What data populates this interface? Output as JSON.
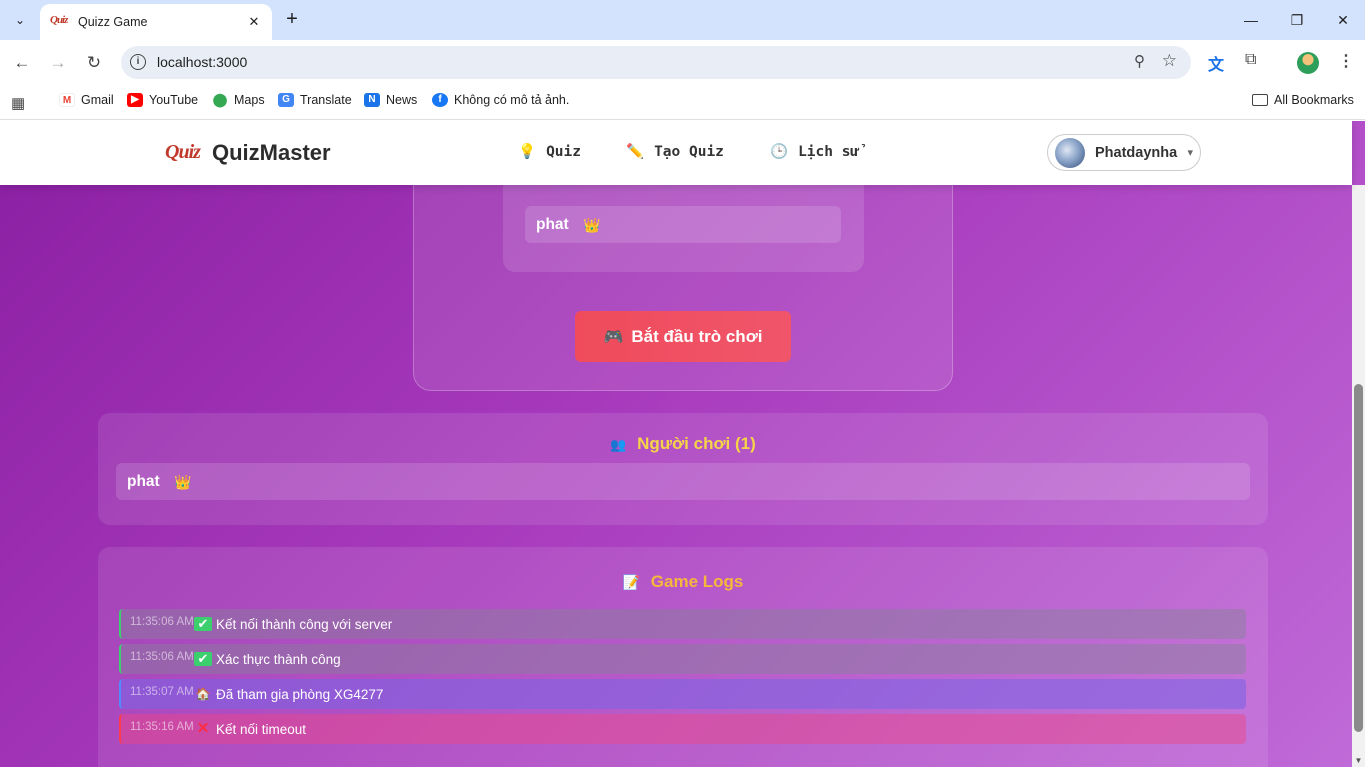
{
  "browser": {
    "tab_title": "Quizz Game",
    "tab_favicon_text": "Quiz",
    "url": "localhost:3000",
    "bookmarks": [
      {
        "label": "Gmail",
        "icon": "gmail-icon"
      },
      {
        "label": "YouTube",
        "icon": "youtube-icon"
      },
      {
        "label": "Maps",
        "icon": "maps-icon"
      },
      {
        "label": "Translate",
        "icon": "translate-icon"
      },
      {
        "label": "News",
        "icon": "news-icon"
      },
      {
        "label": "Không có mô tả ảnh.",
        "icon": "facebook-icon"
      }
    ],
    "all_bookmarks": "All Bookmarks"
  },
  "app": {
    "logo_mark": "Quiz",
    "brand": "QuizMaster",
    "nav": [
      {
        "label": "Quiz",
        "icon": "💡"
      },
      {
        "label": "Tạo Quiz",
        "icon": "✏️"
      },
      {
        "label": "Lịch sử",
        "icon": "🕒"
      }
    ],
    "user": {
      "name": "Phatdaynha",
      "caret": "▾"
    }
  },
  "room": {
    "host_player": {
      "name": "phat",
      "badge": "👑"
    },
    "start_button": {
      "icon": "🎮",
      "label": "Bắt đầu trò chơi"
    }
  },
  "players_panel": {
    "icon": "👥",
    "title": "Người chơi (1)",
    "players": [
      {
        "name": "phat",
        "badge": "👑"
      }
    ]
  },
  "logs_panel": {
    "icon": "📝",
    "title": "Game Logs",
    "entries": [
      {
        "time": "11:35:06 AM",
        "icon": "✔",
        "text": "Kết nối thành công với server",
        "type": "success"
      },
      {
        "time": "11:35:06 AM",
        "icon": "✔",
        "text": "Xác thực thành công",
        "type": "success"
      },
      {
        "time": "11:35:07 AM",
        "icon": "🏠",
        "text": "Đã tham gia phòng XG4277",
        "type": "info"
      },
      {
        "time": "11:35:16 AM",
        "icon": "✕",
        "text": "Kết nối timeout",
        "type": "error"
      }
    ]
  },
  "colors": {
    "accent_yellow": "#f5d547",
    "logs_title": "#f6b73c",
    "success_border": "#3ccf6e",
    "info_border": "#4f8cff",
    "error_border": "#ff3b4d",
    "start_button": "#ef4b5b"
  }
}
